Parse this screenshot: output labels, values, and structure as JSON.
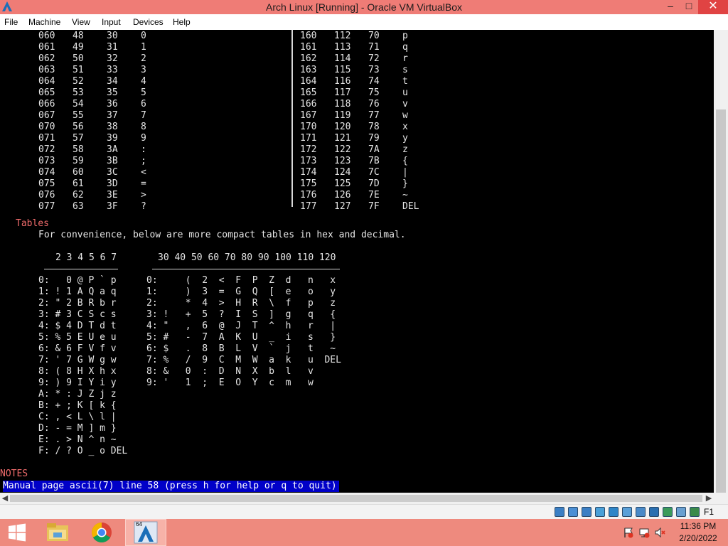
{
  "window": {
    "title": "Arch Linux [Running] - Oracle VM VirtualBox",
    "min_glyph": "–",
    "max_glyph": "□",
    "close_glyph": "✕"
  },
  "menu": [
    "File",
    "Machine",
    "View",
    "Input",
    "Devices",
    "Help"
  ],
  "ascii_left": [
    [
      "060",
      "48",
      "30",
      "0"
    ],
    [
      "061",
      "49",
      "31",
      "1"
    ],
    [
      "062",
      "50",
      "32",
      "2"
    ],
    [
      "063",
      "51",
      "33",
      "3"
    ],
    [
      "064",
      "52",
      "34",
      "4"
    ],
    [
      "065",
      "53",
      "35",
      "5"
    ],
    [
      "066",
      "54",
      "36",
      "6"
    ],
    [
      "067",
      "55",
      "37",
      "7"
    ],
    [
      "070",
      "56",
      "38",
      "8"
    ],
    [
      "071",
      "57",
      "39",
      "9"
    ],
    [
      "072",
      "58",
      "3A",
      ":"
    ],
    [
      "073",
      "59",
      "3B",
      ";"
    ],
    [
      "074",
      "60",
      "3C",
      "<"
    ],
    [
      "075",
      "61",
      "3D",
      "="
    ],
    [
      "076",
      "62",
      "3E",
      ">"
    ],
    [
      "077",
      "63",
      "3F",
      "?"
    ]
  ],
  "ascii_right": [
    [
      "160",
      "112",
      "70",
      "p"
    ],
    [
      "161",
      "113",
      "71",
      "q"
    ],
    [
      "162",
      "114",
      "72",
      "r"
    ],
    [
      "163",
      "115",
      "73",
      "s"
    ],
    [
      "164",
      "116",
      "74",
      "t"
    ],
    [
      "165",
      "117",
      "75",
      "u"
    ],
    [
      "166",
      "118",
      "76",
      "v"
    ],
    [
      "167",
      "119",
      "77",
      "w"
    ],
    [
      "170",
      "120",
      "78",
      "x"
    ],
    [
      "171",
      "121",
      "79",
      "y"
    ],
    [
      "172",
      "122",
      "7A",
      "z"
    ],
    [
      "173",
      "123",
      "7B",
      "{"
    ],
    [
      "174",
      "124",
      "7C",
      "|"
    ],
    [
      "175",
      "125",
      "7D",
      "}"
    ],
    [
      "176",
      "126",
      "7E",
      "~"
    ],
    [
      "177",
      "127",
      "7F",
      "DEL"
    ]
  ],
  "tables_heading": "Tables",
  "tables_intro": "For convenience, below are more compact tables in hex and decimal.",
  "hex_header": "2 3 4 5 6 7",
  "dec_header": "30 40 50 60 70 80 90 100 110 120",
  "hex_rows": [
    "0:   0 @ P ` p",
    "1: ! 1 A Q a q",
    "2: \" 2 B R b r",
    "3: # 3 C S c s",
    "4: $ 4 D T d t",
    "5: % 5 E U e u",
    "6: & 6 F V f v",
    "7: ' 7 G W g w",
    "8: ( 8 H X h x",
    "9: ) 9 I Y i y",
    "A: * : J Z j z",
    "B: + ; K [ k {",
    "C: , < L \\ l |",
    "D: - = M ] m }",
    "E: . > N ^ n ~",
    "F: / ? O _ o DEL"
  ],
  "dec_rows": [
    "0:     (  2  <  F  P  Z  d   n   x",
    "1:     )  3  =  G  Q  [  e   o   y",
    "2:     *  4  >  H  R  \\  f   p   z",
    "3: !   +  5  ?  I  S  ]  g   q   {",
    "4: \"   ,  6  @  J  T  ^  h   r   |",
    "5: #   -  7  A  K  U  _  i   s   }",
    "6: $   .  8  B  L  V  `  j   t   ~",
    "7: %   /  9  C  M  W  a  k   u  DEL",
    "8: &   0  :  D  N  X  b  l   v",
    "9: '   1  ;  E  O  Y  c  m   w"
  ],
  "notes_heading": "NOTES",
  "status_line": "Manual page ascii(7) line 58 (press h for help or q to quit)",
  "vm_status": {
    "host_key": "F1",
    "icons": [
      "hard-disk-icon",
      "optical-drive-icon",
      "audio-icon",
      "network-icon",
      "usb-icon",
      "shared-folders-icon",
      "display-icon",
      "video-capture-icon",
      "mouse-integration-icon",
      "cpu-icon",
      "capture-icon"
    ]
  },
  "taskbar": {
    "time": "11:36 PM",
    "date": "2/20/2022",
    "vbox_badge": "64"
  }
}
